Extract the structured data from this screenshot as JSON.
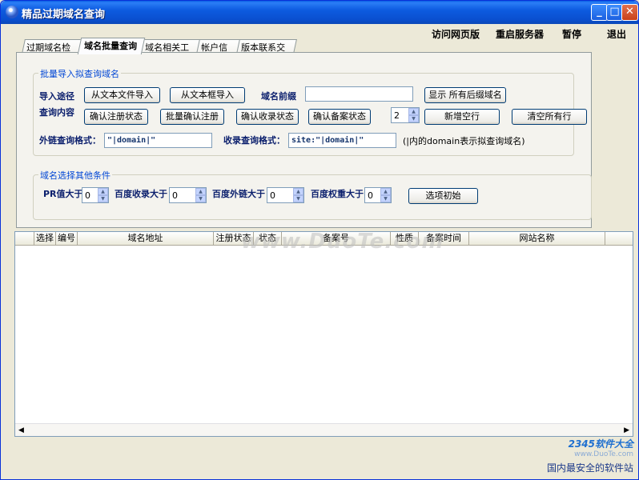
{
  "window": {
    "title": "精品过期域名查询"
  },
  "top_menu": {
    "visit": "访问网页版",
    "restart": "重启服务器",
    "pause": "暂停",
    "exit": "退出"
  },
  "tabs": [
    "过期域名检索",
    "域名批量查询",
    "域名相关工具",
    "帐户信息",
    "版本联系交流"
  ],
  "batch_group": {
    "legend": "批量导入拟查询域名",
    "import_path_label": "导入途径",
    "import_text_file": "从文本文件导入",
    "import_text_box": "从文本框导入",
    "domain_prefix_label": "域名前缀",
    "domain_prefix_value": "",
    "show_suffix_btn": "显示 所有后缀域名",
    "query_content_label": "查询内容",
    "confirm_reg": "确认注册状态",
    "batch_confirm_reg": "批量确认注册",
    "confirm_index": "确认收录状态",
    "confirm_record": "确认备案状态",
    "spin_value": "2",
    "add_empty_row": "新增空行",
    "clear_all_rows": "清空所有行",
    "link_format_label": "外链查询格式：",
    "link_format_value": "\"|domain|\"",
    "index_format_label": "收录查询格式：",
    "index_format_value": "site:\"|domain|\"",
    "note": "(|内的domain表示拟查询域名)"
  },
  "filter_group": {
    "legend": "域名选择其他条件",
    "pr_label": "PR值大于",
    "pr_value": "0",
    "baidu_index_label": "百度收录大于",
    "baidu_index_value": "0",
    "baidu_links_label": "百度外链大于",
    "baidu_links_value": "0",
    "baidu_weight_label": "百度权重大于",
    "baidu_weight_value": "0",
    "reset_btn": "选项初始"
  },
  "grid": {
    "columns": [
      "选择",
      "编号",
      "域名地址",
      "注册状态",
      "状态",
      "备案号",
      "性质",
      "备案时间",
      "网站名称"
    ]
  },
  "watermarks": {
    "duote": "www.DuoTe.com",
    "brand": "2345软件大全",
    "url": "www.DuoTe.com",
    "slogan": "国内最安全的软件站"
  }
}
